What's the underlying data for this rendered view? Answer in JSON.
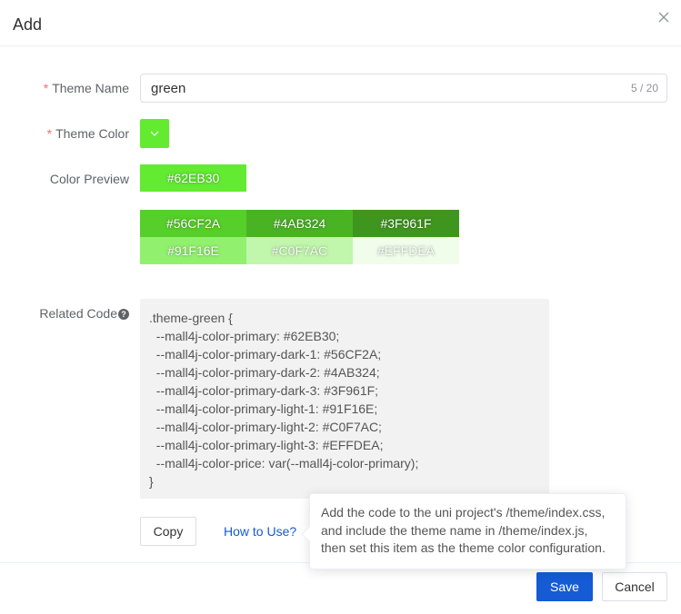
{
  "dialog": {
    "title": "Add",
    "close_icon": "close-icon"
  },
  "form": {
    "theme_name_label": "Theme Name",
    "theme_name_value": "green",
    "theme_name_count": "5 / 20",
    "theme_color_label": "Theme Color",
    "theme_color_value": "#62EB30",
    "color_preview_label": "Color Preview",
    "related_code_label": "Related Code",
    "help_icon": "question-circle-icon",
    "required_mark": "*"
  },
  "preview": {
    "primary": {
      "label": "#62EB30",
      "color": "#62EB30"
    },
    "dark": [
      {
        "label": "#56CF2A",
        "color": "#56CF2A"
      },
      {
        "label": "#4AB324",
        "color": "#4AB324"
      },
      {
        "label": "#3F961F",
        "color": "#3F961F"
      }
    ],
    "light": [
      {
        "label": "#91F16E",
        "color": "#91F16E"
      },
      {
        "label": "#C0F7AC",
        "color": "#C0F7AC"
      },
      {
        "label": "#EFFDEA",
        "color": "#EFFDEA"
      }
    ]
  },
  "code": ".theme-green {\n  --mall4j-color-primary: #62EB30;\n  --mall4j-color-primary-dark-1: #56CF2A;\n  --mall4j-color-primary-dark-2: #4AB324;\n  --mall4j-color-primary-dark-3: #3F961F;\n  --mall4j-color-primary-light-1: #91F16E;\n  --mall4j-color-primary-light-2: #C0F7AC;\n  --mall4j-color-primary-light-3: #EFFDEA;\n  --mall4j-color-price: var(--mall4j-color-primary);\n}",
  "actions": {
    "copy_label": "Copy",
    "how_to_use_label": "How to Use?",
    "tooltip_text": "Add the code to the uni project's /theme/index.css, and include the theme name in /theme/index.js, then set this item as the theme color configuration.",
    "save_label": "Save",
    "cancel_label": "Cancel"
  },
  "colors": {
    "accent": "#155BD4",
    "required": "#F56C6C"
  }
}
